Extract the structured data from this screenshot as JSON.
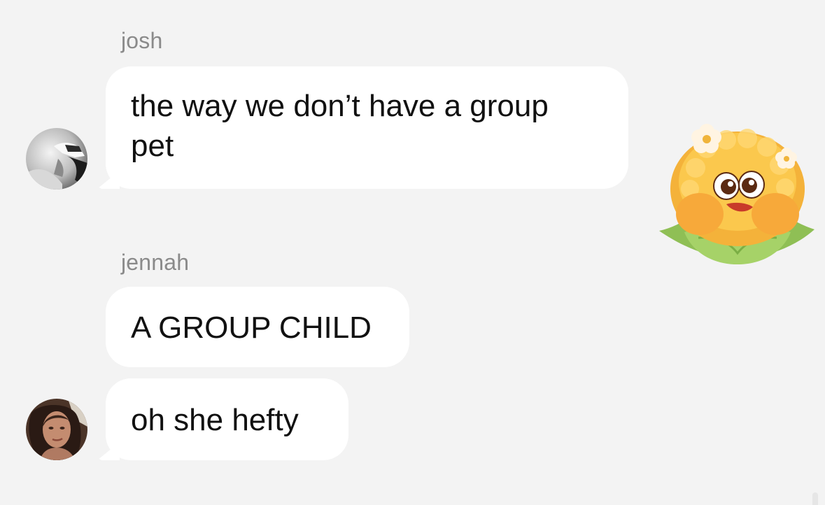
{
  "messages": [
    {
      "sender": "josh",
      "lines": [
        "the way we don’t have a group",
        "pet"
      ],
      "avatar_icon": "avatar-photo-grayscale"
    },
    {
      "sender": "jennah",
      "lines": [
        "A GROUP CHILD"
      ]
    },
    {
      "lines": [
        "oh she hefty"
      ],
      "avatar_icon": "avatar-photo-color"
    }
  ],
  "sticker": {
    "icon": "corn-character-sticker"
  },
  "colors": {
    "background": "#f3f3f3",
    "bubble": "#ffffff",
    "sender_text": "#8a8a8a",
    "message_text": "#111111"
  }
}
